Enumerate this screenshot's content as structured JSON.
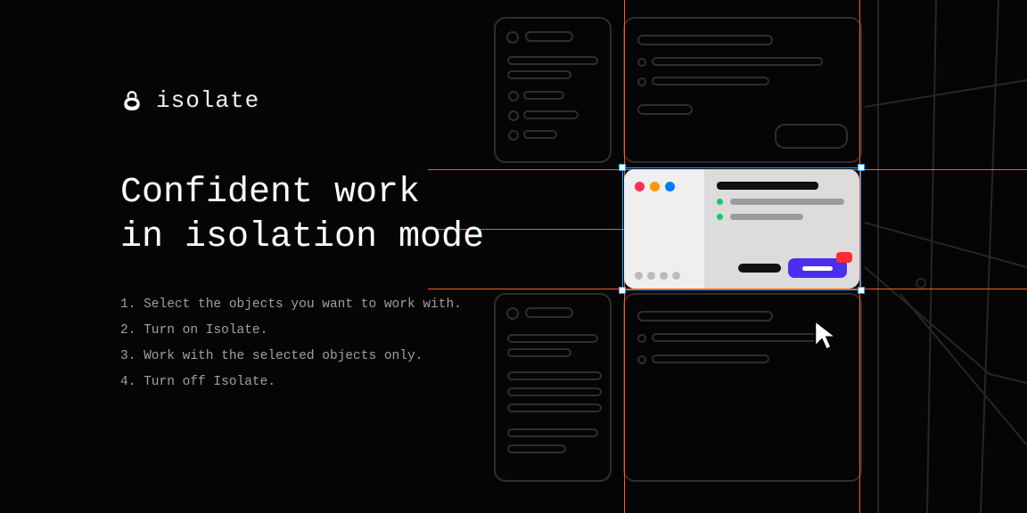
{
  "brand": {
    "name": "isolate"
  },
  "headline": "Confident work\nin isolation mode",
  "steps": [
    "Select the objects you want to work with.",
    "Turn on Isolate.",
    "Work with the selected objects only.",
    "Turn off Isolate."
  ],
  "colors": {
    "guide": "#ff5a1f",
    "selection": "#2aa3ff",
    "primary_button": "#4b2ff0"
  }
}
